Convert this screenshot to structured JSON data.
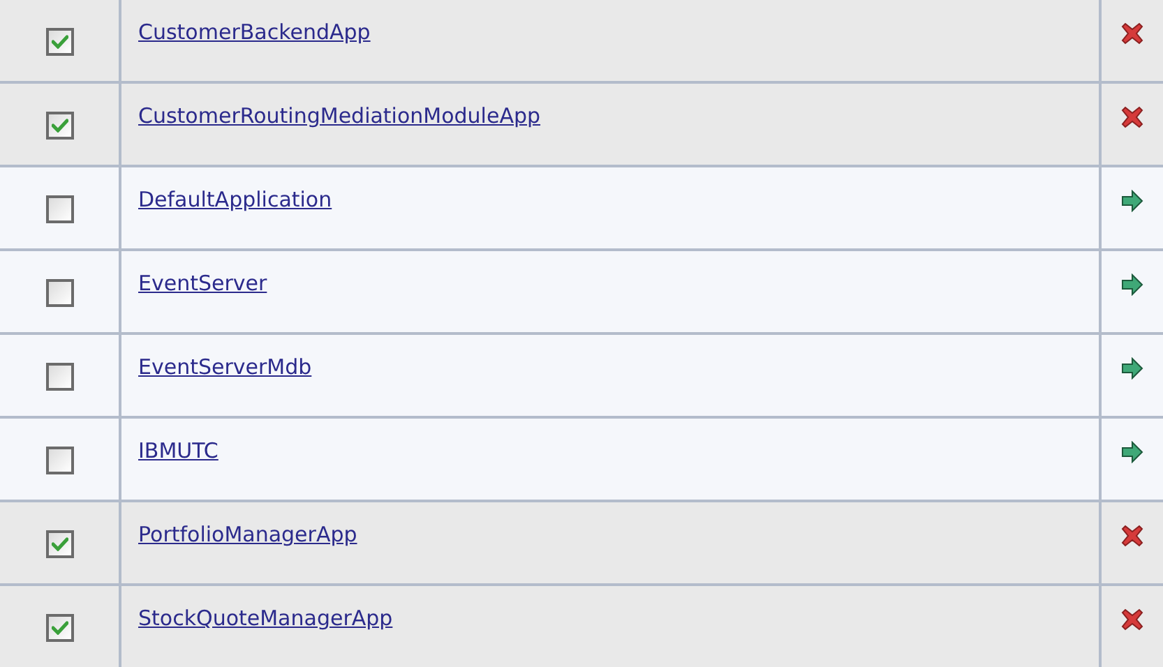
{
  "applications": [
    {
      "name": "CustomerBackendApp",
      "checked": true,
      "kind": "stopped"
    },
    {
      "name": "CustomerRoutingMediationModuleApp",
      "checked": true,
      "kind": "stopped"
    },
    {
      "name": "DefaultApplication",
      "checked": false,
      "kind": "started"
    },
    {
      "name": "EventServer",
      "checked": false,
      "kind": "started"
    },
    {
      "name": "EventServerMdb",
      "checked": false,
      "kind": "started"
    },
    {
      "name": "IBMUTC",
      "checked": false,
      "kind": "started"
    },
    {
      "name": "PortfolioManagerApp",
      "checked": true,
      "kind": "stopped"
    },
    {
      "name": "StockQuoteManagerApp",
      "checked": true,
      "kind": "stopped"
    }
  ]
}
